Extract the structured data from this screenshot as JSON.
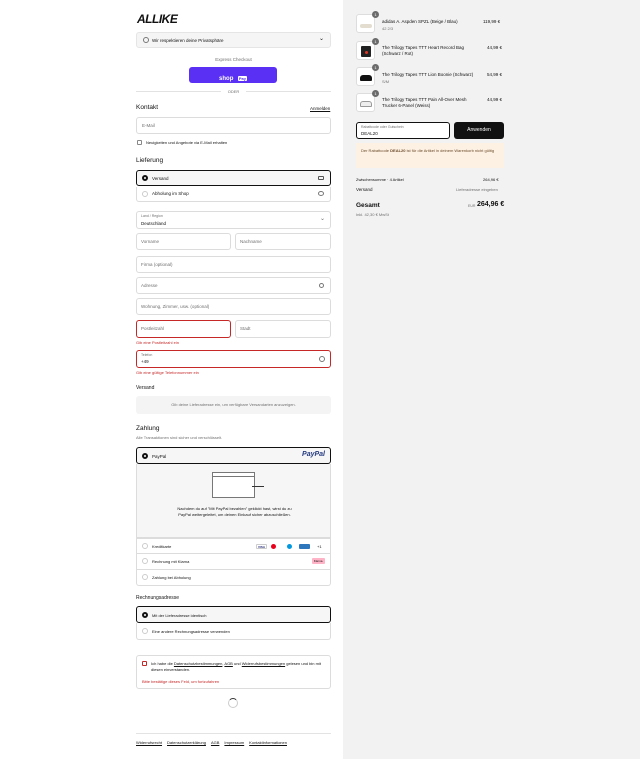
{
  "brand": {
    "logo_text": "ALLIKE"
  },
  "privacy_banner": {
    "text": "Wir respektieren deine Privatsphäre"
  },
  "express": {
    "label": "Express Checkout",
    "shop_pay": "shop",
    "shop_pay_badge": "Pay",
    "or": "ODER"
  },
  "contact": {
    "title": "Kontakt",
    "login": "Anmelden",
    "email_placeholder": "E-Mail",
    "newsletter": "Neuigkeiten und Angebote via E-Mail erhalten"
  },
  "delivery": {
    "title": "Lieferung",
    "options": [
      "Versand",
      "Abholung im Shop"
    ],
    "country_label": "Land / Region",
    "country_value": "Deutschland",
    "first_name": "Vorname",
    "last_name": "Nachname",
    "company": "Firma (optional)",
    "address": "Adresse",
    "address2": "Wohnung, Zimmer, usw. (optional)",
    "zip": "Postleitzahl",
    "city": "Stadt",
    "zip_error": "Gib eine Postleitzahl ein",
    "phone_label": "Telefon",
    "phone_value": "+49",
    "phone_error": "Gib eine gültige Telefonnummer ein",
    "shipping_title": "Versand",
    "shipping_info": "Gib deine Lieferadresse ein, um verfügbare Versandarten anzuzeigen."
  },
  "payment": {
    "title": "Zahlung",
    "subtitle": "Alle Transaktionen sind sicher und verschlüsselt.",
    "paypal_label": "PayPal",
    "paypal_logo": "PayPal",
    "paypal_info": "Nachdem du auf \"Mit PayPal bezahlen\" geklickt hast, wirst du zu PayPal weitergeleitet, um deinen Einkauf sicher abzuschließen.",
    "credit_card": "Kreditkarte",
    "card_brands": [
      "VISA",
      "MC",
      "MAES",
      "AMEX"
    ],
    "cards_more": "+1",
    "klarna": "Rechnung mit Klarna",
    "klarna_badge": "Klarna.",
    "pickup_pay": "Zahlung bei Abholung"
  },
  "billing": {
    "title": "Rechnungsadresse",
    "same": "Mit der Lieferadresse identisch",
    "other": "Eine andere Rechnungsadresse verwenden"
  },
  "terms": {
    "prefix": "Ich habe die ",
    "privacy": "Datenschutzbestimmungen",
    "comma": ", ",
    "agb": "AGB",
    "and": " und ",
    "withdrawal": "Widerrufsbestimmungen",
    "suffix": " gelesen und bin mit diesen einverstanden.",
    "error": "Bitte bestätige dieses Feld, um fortzufahren"
  },
  "footer": [
    "Widerrufsrecht",
    "Datenschutzerklärung",
    "AGB",
    "Impressum",
    "Kontaktinformationen"
  ],
  "cart": {
    "items": [
      {
        "qty": "1",
        "name": "adidas A. Aspden SPZL (Beige / Blau)",
        "variant": "42 2/3",
        "price": "119,99 €"
      },
      {
        "qty": "1",
        "name": "The Trilogy Tapes TTT Heart Record Bag (Schwarz / Rot)",
        "variant": "",
        "price": "44,99 €"
      },
      {
        "qty": "1",
        "name": "The Trilogy Tapes TTT Lion Boonie (Schwarz)",
        "variant": "S/M",
        "price": "54,99 €"
      },
      {
        "qty": "1",
        "name": "The Trilogy Tapes TTT Pain All-Over Mesh Trucker 6-Panel (Weiss)",
        "variant": "",
        "price": "44,99 €"
      }
    ],
    "discount_label": "Rabattcode oder Gutschein",
    "discount_value": "DEAL20",
    "apply": "Anwenden",
    "notice_prefix": "Der Rabattcode ",
    "notice_code": "DEAL20",
    "notice_suffix": " ist für die Artikel in deinem Warenkorb nicht gültig",
    "subtotal_label": "Zwischensumme · 4 Artikel",
    "subtotal_value": "264,96 €",
    "shipping_label": "Versand",
    "shipping_value": "Lieferadresse eingeben",
    "total_label": "Gesamt",
    "total_currency": "EUR",
    "total_value": "264,96 €",
    "tax_note": "Inkl. 42,30 € MwSt"
  },
  "colors": {
    "accent": "#5a31f4",
    "error": "#c62828",
    "paypal_blue": "#253b80",
    "paypal_light": "#179bd7",
    "notice_bg": "#fdf1e3"
  }
}
